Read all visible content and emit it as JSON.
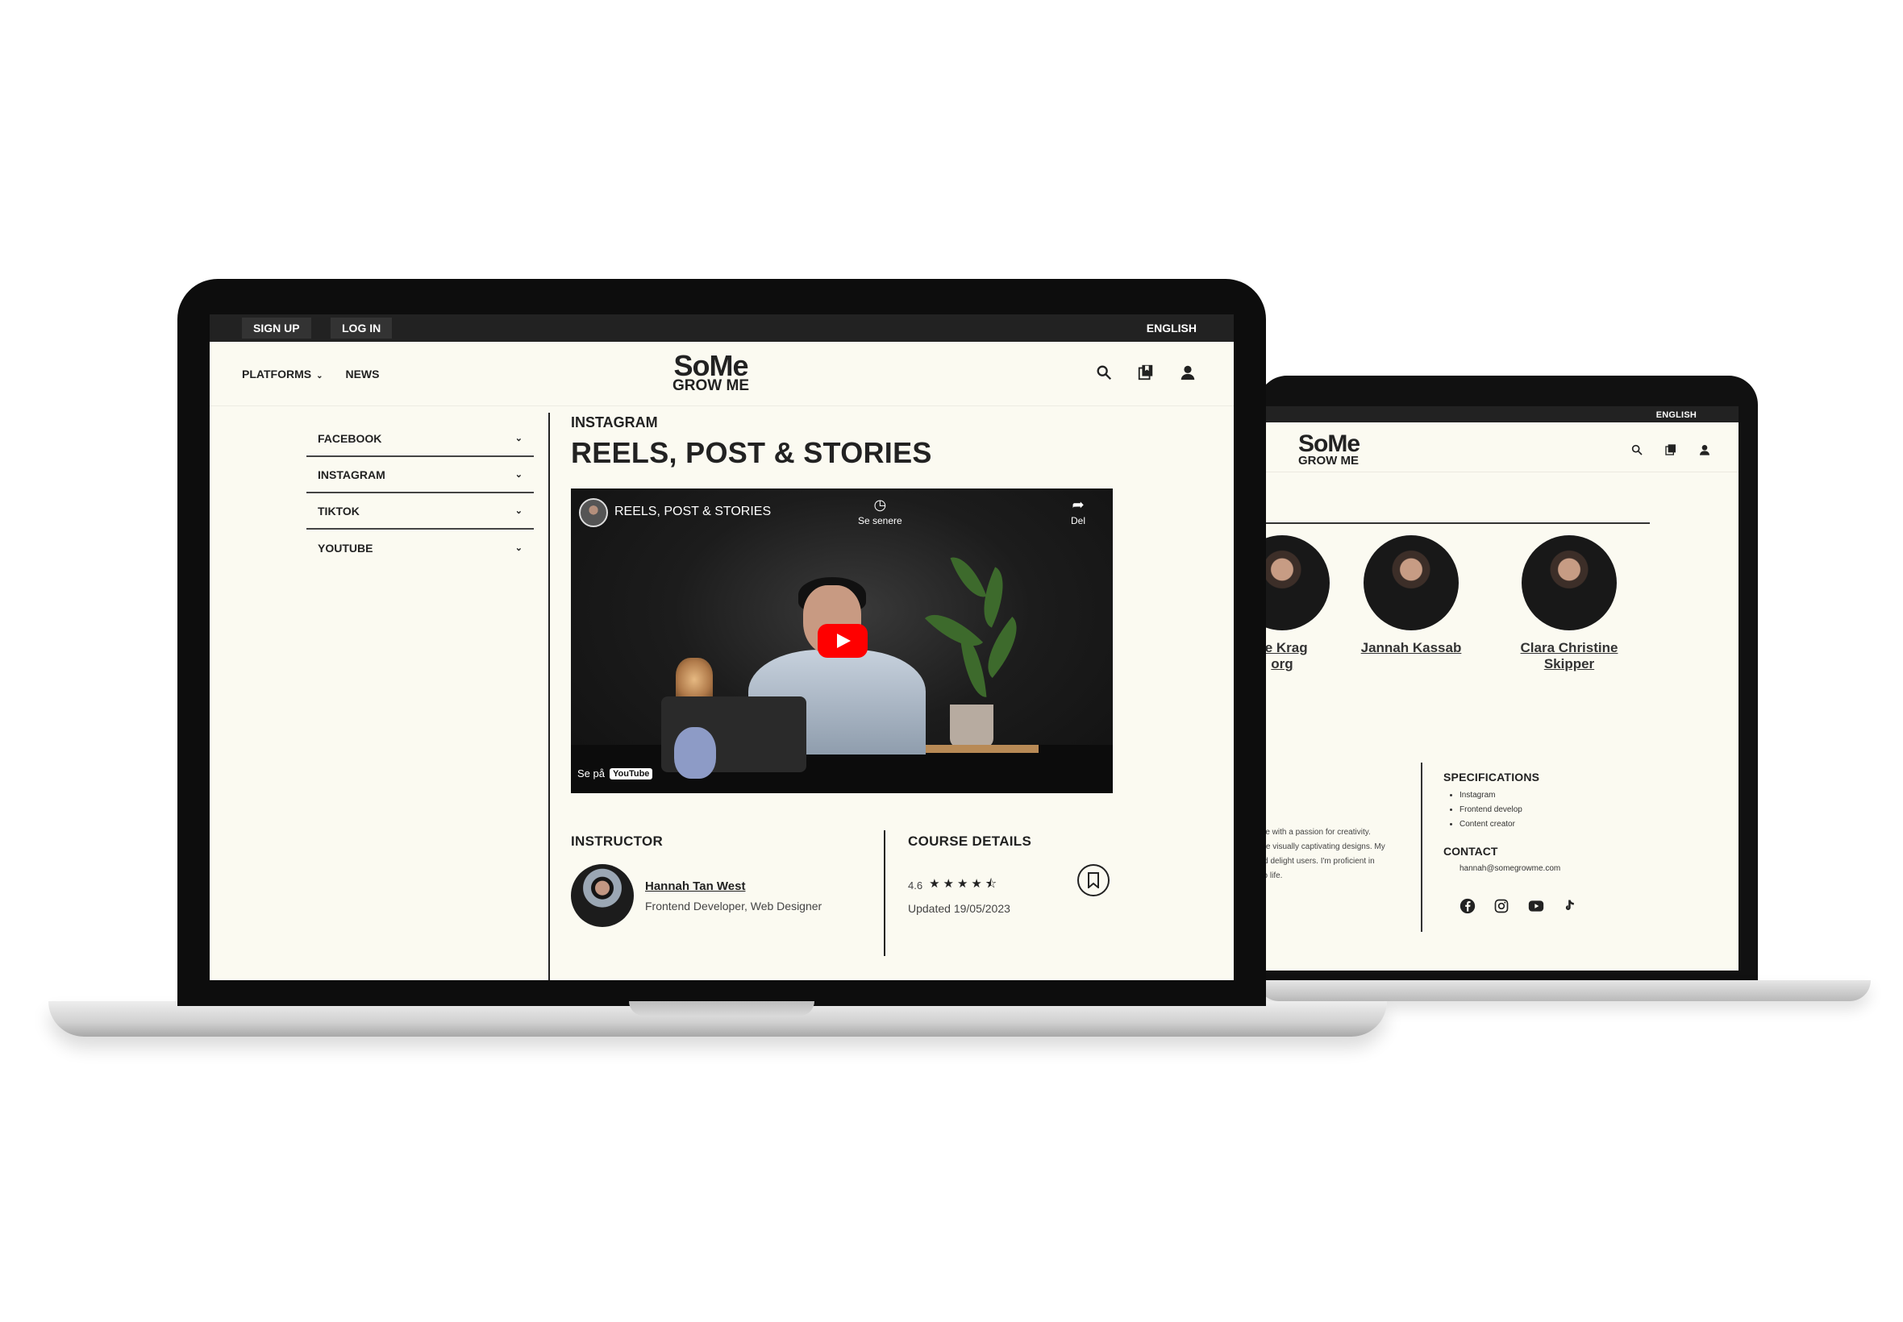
{
  "back_screen": {
    "language": "ENGLISH",
    "logo": {
      "line1": "SoMe",
      "line2": "GROW ME"
    },
    "instructors": [
      {
        "name_line1": "lte Krag",
        "name_line2": "org"
      },
      {
        "name_line1": "Jannah Kassab",
        "name_line2": ""
      },
      {
        "name_line1": "Clara Christine",
        "name_line2": "Skipper"
      }
    ],
    "bio_lines": [
      "rtise with a passion for creativity.",
      "eate visually captivating designs. My",
      "and delight users. I'm proficient in",
      "s to life."
    ],
    "specifications": {
      "heading": "SPECIFICATIONS",
      "items": [
        "Instagram",
        "Frontend develop",
        "Content creator"
      ]
    },
    "contact": {
      "heading": "CONTACT",
      "email": "hannah@somegrowme.com"
    },
    "socials": [
      "facebook-icon",
      "instagram-icon",
      "youtube-icon",
      "tiktok-icon"
    ]
  },
  "front_screen": {
    "topbar": {
      "sign_up": "SIGN UP",
      "log_in": "LOG IN",
      "language": "ENGLISH"
    },
    "nav": {
      "platforms": "PLATFORMS",
      "news": "NEWS"
    },
    "logo": {
      "line1": "SoMe",
      "line2": "GROW ME"
    },
    "sidebar": [
      "FACEBOOK",
      "INSTAGRAM",
      "TIKTOK",
      "YOUTUBE"
    ],
    "eyebrow": "INSTAGRAM",
    "title": "REELS, POST & STORIES",
    "video": {
      "title": "REELS, POST & STORIES",
      "watch_later": "Se senere",
      "share": "Del",
      "watch_on": "Se på",
      "youtube": "YouTube"
    },
    "instructor": {
      "heading": "INSTRUCTOR",
      "name": "Hannah Tan West",
      "role": "Frontend Developer, Web Designer"
    },
    "course_details": {
      "heading": "COURSE DETAILS",
      "rating": "4.6",
      "rating_value": 4.6,
      "rating_max": 5,
      "updated": "Updated 19/05/2023"
    }
  },
  "colors": {
    "topbar": "#222222",
    "page_bg": "#fbfaf1",
    "text": "#222222",
    "play_button": "#ff0000"
  }
}
